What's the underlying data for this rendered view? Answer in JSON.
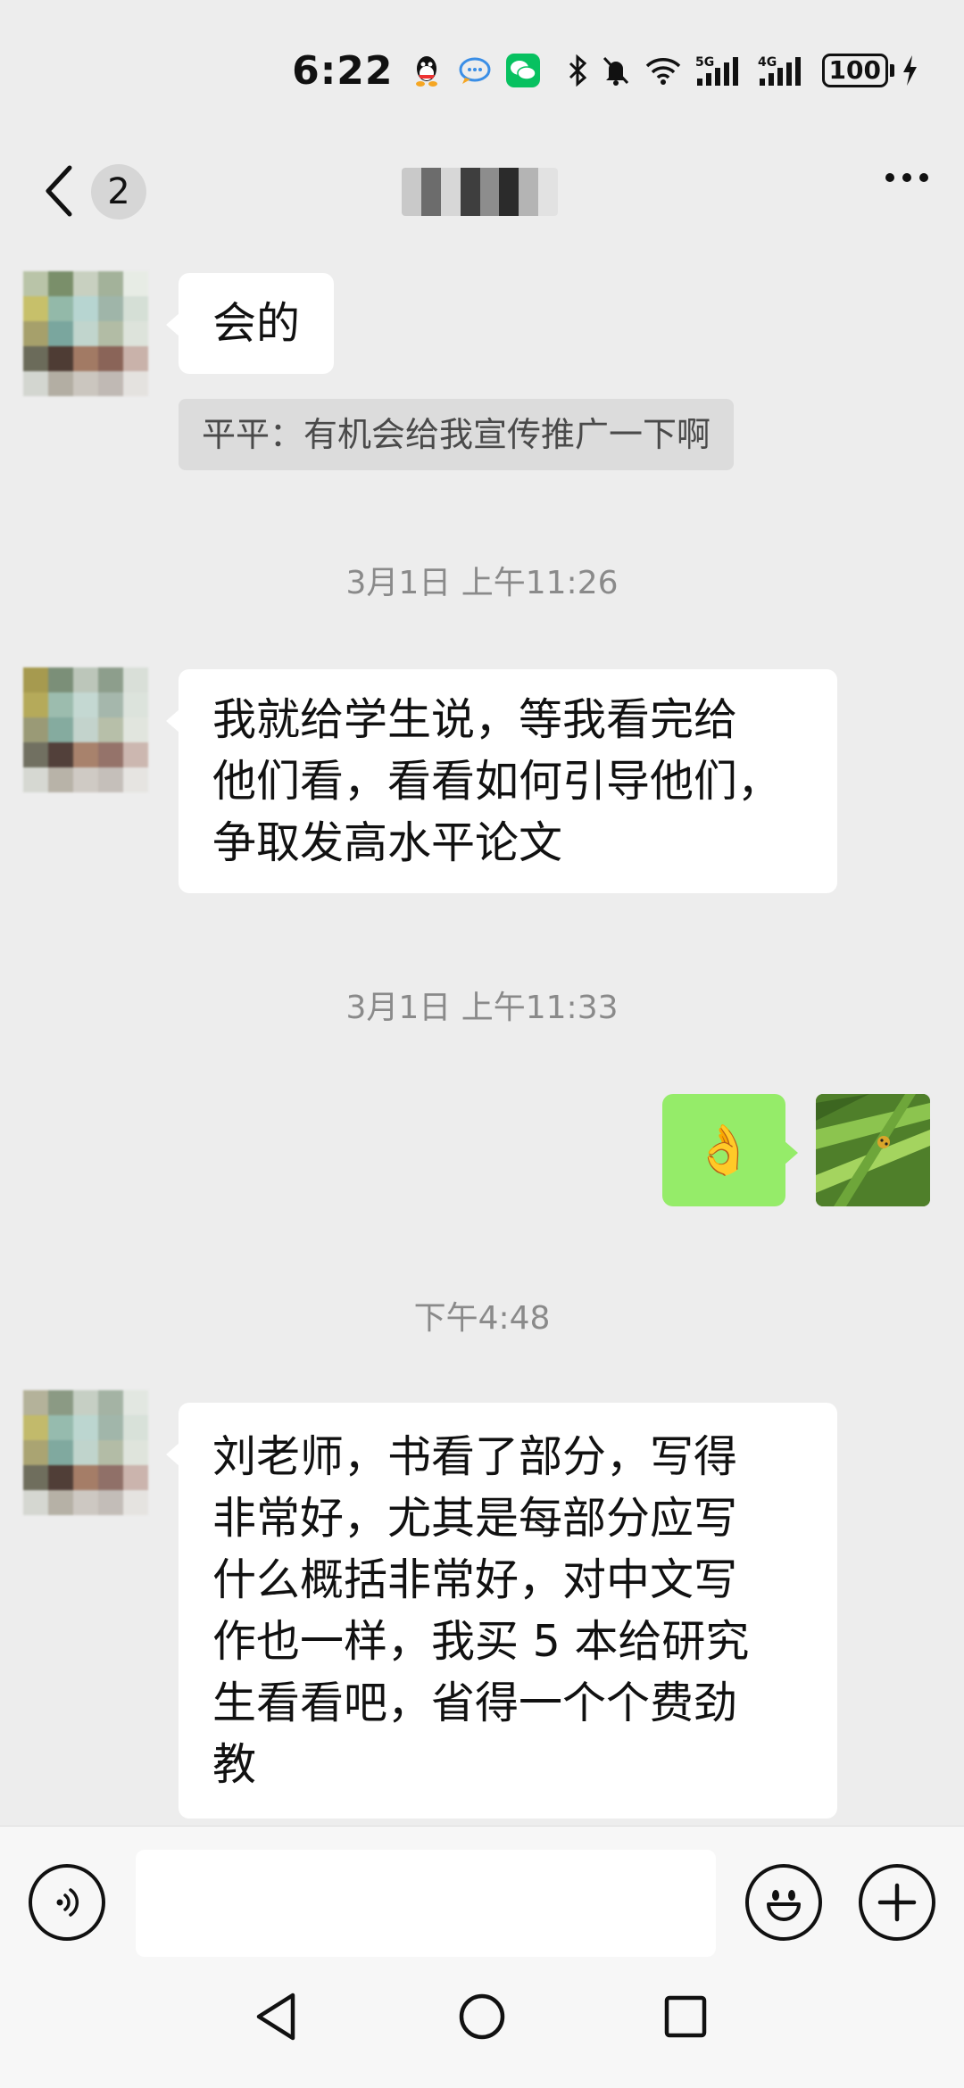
{
  "status_bar": {
    "time": "6:22",
    "battery": "100",
    "network_labels": [
      "5G",
      "4G"
    ]
  },
  "header": {
    "back_badge_count": "2",
    "contact_name": ""
  },
  "messages": [
    {
      "side": "left",
      "text": "会的"
    },
    {
      "quote": "平平：有机会给我宣传推广一下啊"
    },
    {
      "timestamp": "3月1日 上午11:26"
    },
    {
      "side": "left",
      "lines": [
        "我就给学生说，等我看完给",
        "他们看，看看如何引导他们，",
        "争取发高水平论文"
      ]
    },
    {
      "timestamp": "3月1日 上午11:33"
    },
    {
      "side": "right",
      "emoji": "👌"
    },
    {
      "timestamp": "下午4:48"
    },
    {
      "side": "left",
      "lines": [
        "刘老师，书看了部分，写得",
        "非常好，尤其是每部分应写",
        "什么概括非常好，对中文写",
        "作也一样，我买 5 本给研究",
        "生看看吧，省得一个个费劲",
        "教"
      ]
    }
  ],
  "input": {
    "value": "",
    "placeholder": ""
  },
  "icons": {
    "back": "chevron-left-icon",
    "more": "more-dots-icon",
    "voice": "voice-icon",
    "emoji": "emoji-icon",
    "plus": "plus-icon",
    "nav_back": "triangle-back-icon",
    "nav_home": "circle-home-icon",
    "nav_recent": "square-recent-icon"
  },
  "colors": {
    "background": "#ededed",
    "incoming_bubble": "#ffffff",
    "outgoing_bubble": "#95ec69",
    "timestamp": "#8a8a8a"
  }
}
